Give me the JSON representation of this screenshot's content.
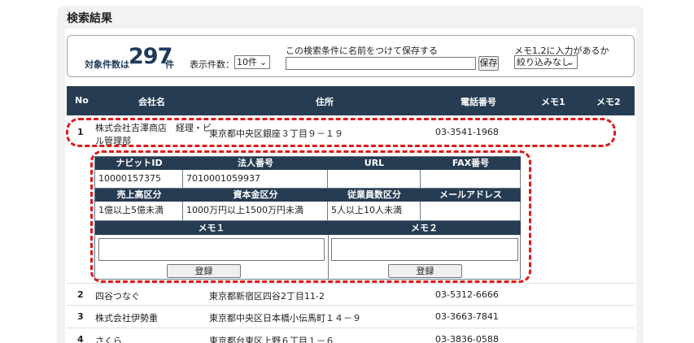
{
  "panel": {
    "title": "検索結果"
  },
  "search": {
    "count_label": "対象件数は",
    "count": "297",
    "count_unit": "件",
    "perpage_label": "表示件数：",
    "perpage_value": "10件",
    "save_label": "この検索条件に名前をつけて保存する",
    "save_value": "",
    "save_button": "保存",
    "memo_filter_label": "メモ1,2に入力があるか",
    "memo_filter_value": "絞り込みなし"
  },
  "table": {
    "headers": {
      "no": "No",
      "company": "会社名",
      "address": "住所",
      "phone": "電話番号",
      "memo1": "メモ1",
      "memo2": "メモ2"
    },
    "rows": [
      {
        "no": "1",
        "company_line1": "株式会社吉澤商店　経理・ビ",
        "company_line2": "ル管理部",
        "address": "東京都中央区銀座３丁目９－１９",
        "phone": "03-3541-1968"
      },
      {
        "no": "2",
        "company": "四谷つなぐ",
        "address": "東京都新宿区四谷2丁目11-2",
        "phone": "03-5312-6666"
      },
      {
        "no": "3",
        "company": "株式会社伊勢重",
        "address": "東京都中央区日本橋小伝馬町１４－９",
        "phone": "03-3663-7841"
      },
      {
        "no": "4",
        "company": "さくら",
        "address": "東京都台東区上野６丁目１－６",
        "phone": "03-3836-0588"
      }
    ]
  },
  "detail": {
    "headers1": [
      "ナビットID",
      "法人番号",
      "URL",
      "FAX番号"
    ],
    "values1": [
      "10000157375",
      "7010001059937",
      "",
      ""
    ],
    "headers2": [
      "売上高区分",
      "資本金区分",
      "従業員数区分",
      "メールアドレス"
    ],
    "values2": [
      "1億以上5億未満",
      "1000万円以上1500万円未満",
      "5人以上10人未満",
      ""
    ],
    "memo1_header": "メモ１",
    "memo2_header": "メモ２",
    "memo1_value": "",
    "memo2_value": "",
    "register_label": "登録"
  },
  "colors": {
    "header_bg": "#263c52",
    "highlight": "#e01a1a"
  }
}
